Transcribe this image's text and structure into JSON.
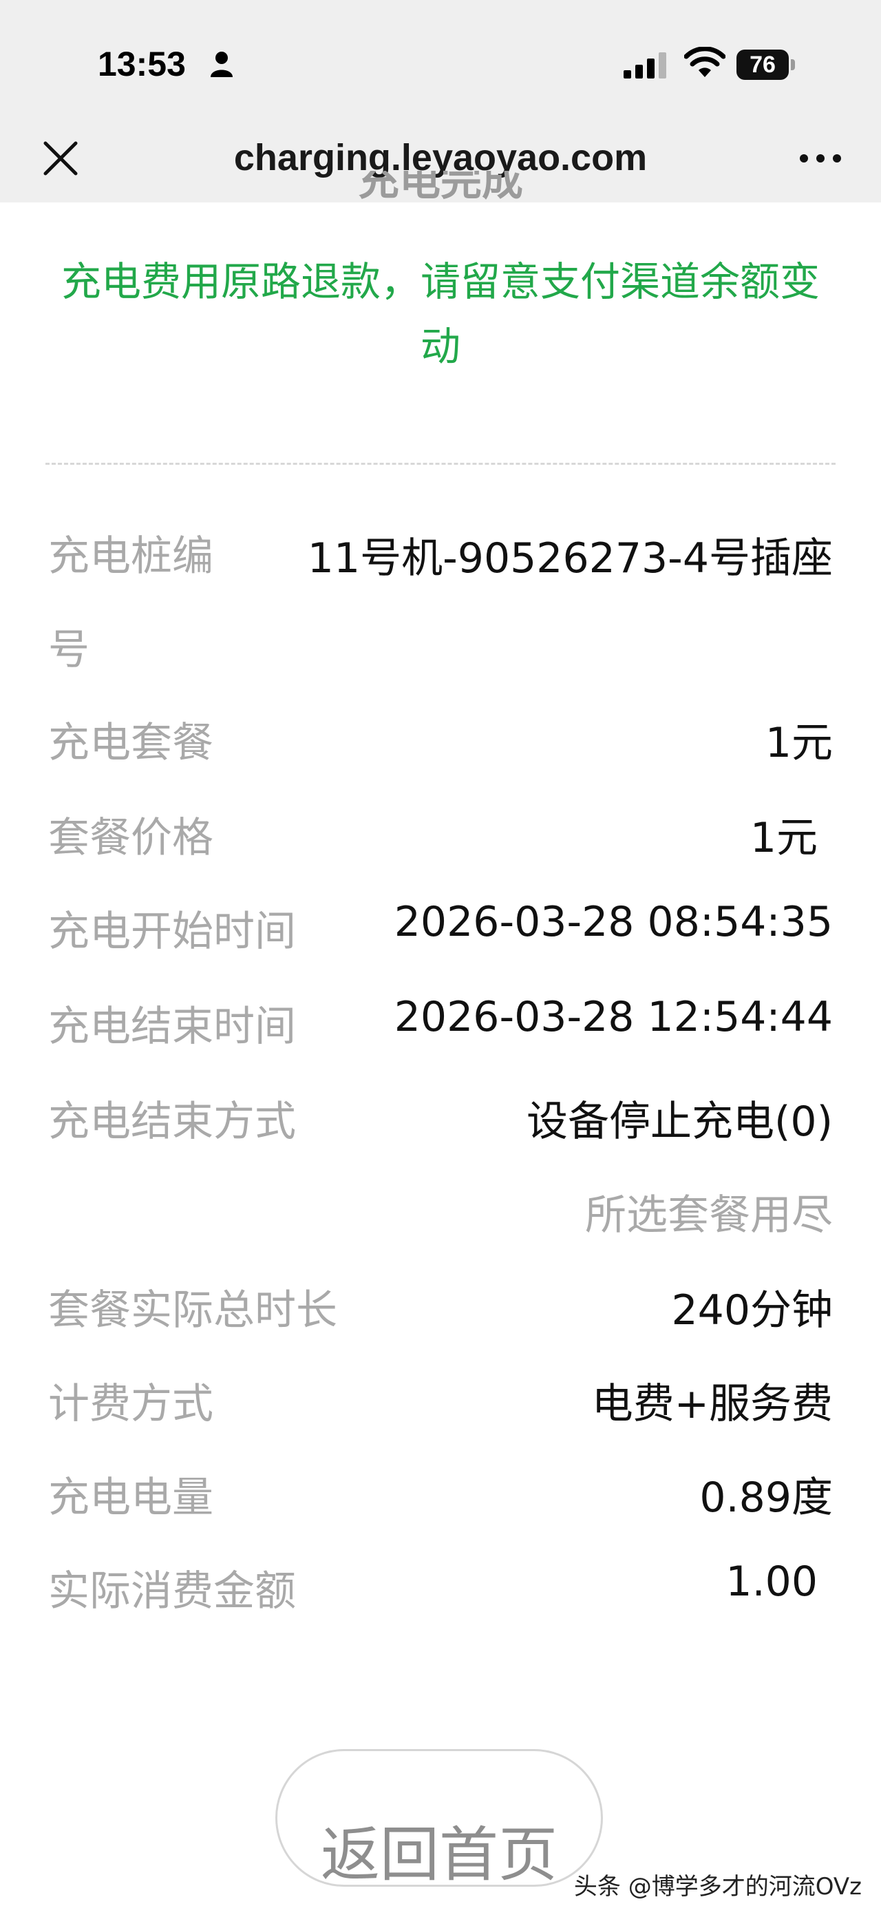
{
  "status_bar": {
    "time": "13:53",
    "battery": "76",
    "icons": [
      "person-icon",
      "signal-icon",
      "wifi-icon",
      "battery-icon"
    ]
  },
  "nav": {
    "title": "charging.leyaoyao.com",
    "close_icon": "close-icon",
    "more_icon": "more-icon"
  },
  "content": {
    "heading_cut": "充电完成",
    "refund_notice": "充电费用原路退款，请留意支付渠道余额变动",
    "details": [
      {
        "label": "充电桩编号",
        "value": "11号机-90526273-4号插座"
      },
      {
        "label": "充电套餐",
        "value": "1元"
      },
      {
        "label": "套餐价格",
        "value": "1元"
      },
      {
        "label": "充电开始时间",
        "value": "2026-03-28 08:54:35"
      },
      {
        "label": "充电结束时间",
        "value": "2026-03-28 12:54:44"
      },
      {
        "label": "充电结束方式",
        "value": "设备停止充电(0)",
        "note": "所选套餐用尽"
      },
      {
        "label": "套餐实际总时长",
        "value": "240分钟"
      },
      {
        "label": "计费方式",
        "value": "电费+服务费"
      },
      {
        "label": "充电电量",
        "value": "0.89度"
      },
      {
        "label": "实际消费金额",
        "value": "1.00"
      }
    ],
    "home_button": "返回首页",
    "watermark": "头条 @博学多才的河流OVz"
  },
  "colors": {
    "accent_green": "#22a84a",
    "label_gray": "#a9a9a9",
    "chrome_bg": "#efefef"
  }
}
